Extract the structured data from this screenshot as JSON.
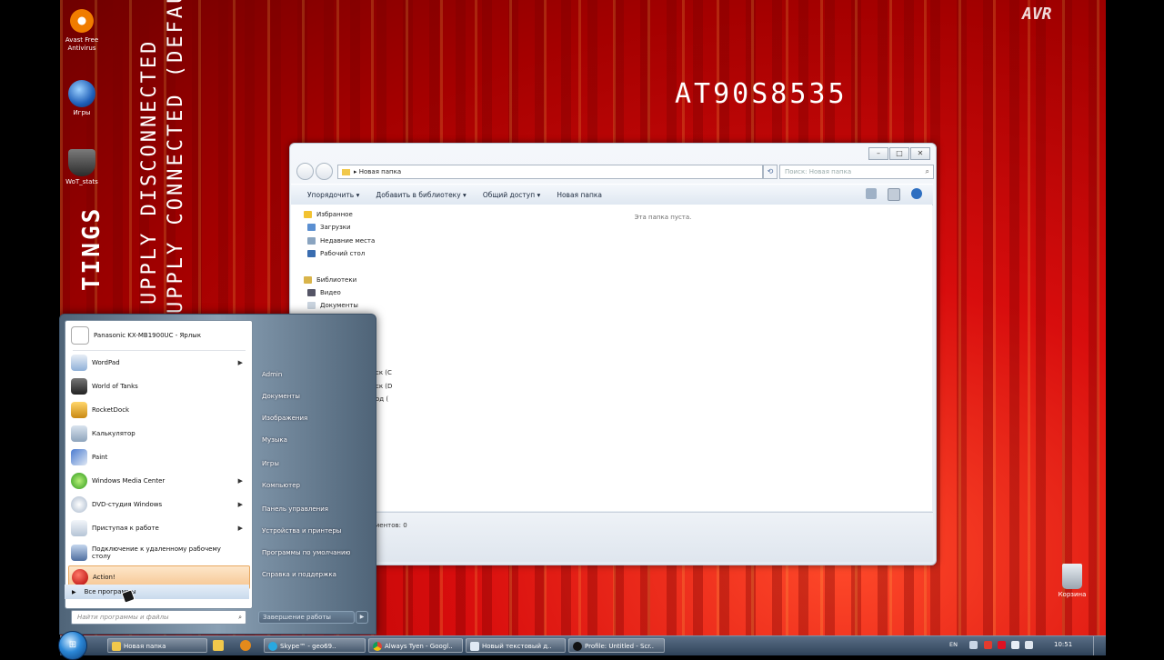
{
  "desktop": {
    "icons": [
      {
        "label": "Avast Free Antivirus",
        "icon": "avast-icon"
      },
      {
        "label": "Игры",
        "icon": "games-icon"
      },
      {
        "label": "WoT_stats",
        "icon": "world-of-tanks-icon"
      }
    ],
    "chip_text": "AT90S8535",
    "avr_logo": "AVR",
    "vertical_text_1": "UPPLY DISCONNECTED",
    "vertical_text_2": "UPPLY CONNECTED (DEFAULT)",
    "side_text": "TINGS",
    "recycle_bin": "Корзина"
  },
  "explorer": {
    "address": "Новая папка",
    "search_placeholder": "Поиск: Новая папка",
    "toolbar": {
      "organize": "Упорядочить",
      "add_library": "Добавить в библиотеку",
      "share": "Общий доступ",
      "new_folder": "Новая папка"
    },
    "nav": {
      "favorites": "Избранное",
      "downloads": "Загрузки",
      "recent": "Недавние места",
      "desktop": "Рабочий стол",
      "libraries": "Библиотеки",
      "video": "Видео",
      "documents": "Документы"
    },
    "empty_text": "Эта папка пуста.",
    "details_text": "ментов: 0",
    "drive_frag_1": "ск (C",
    "drive_frag_2": "ск (D",
    "drive_frag_3": "од ("
  },
  "start_menu": {
    "pinned": "Panasonic KX-MB1900UC - Ярлык",
    "programs": [
      {
        "label": "WordPad",
        "arrow": true
      },
      {
        "label": "World of Tanks",
        "arrow": false
      },
      {
        "label": "RocketDock",
        "arrow": false
      },
      {
        "label": "Калькулятор",
        "arrow": false
      },
      {
        "label": "Paint",
        "arrow": false
      },
      {
        "label": "Windows Media Center",
        "arrow": true
      },
      {
        "label": "DVD-студия Windows",
        "arrow": true
      },
      {
        "label": "Приступая к работе",
        "arrow": true
      },
      {
        "label": "Подключение к удаленному рабочему столу",
        "arrow": false
      },
      {
        "label": "Action!",
        "arrow": false
      }
    ],
    "all_programs": "Все программы",
    "search_placeholder": "Найти программы и файлы",
    "right_items": [
      "Admin",
      "Документы",
      "Изображения",
      "Музыка",
      "Игры",
      "Компьютер",
      "Панель управления",
      "Устройства и принтеры",
      "Программы по умолчанию",
      "Справка и поддержка"
    ],
    "shutdown": "Завершение работы"
  },
  "taskbar": {
    "buttons": [
      {
        "label": "Новая папка",
        "icon": "folder-icon"
      },
      {
        "label": "Skype™ - geo69..",
        "icon": "skype-icon"
      },
      {
        "label": "Always Tyen - Googl..",
        "icon": "chrome-icon"
      },
      {
        "label": "Новый текстовый д..",
        "icon": "notepad-icon"
      },
      {
        "label": "Profile: Untitled - Scr..",
        "icon": "recorder-icon"
      }
    ],
    "tray_lang": "EN",
    "clock": "10:51"
  }
}
